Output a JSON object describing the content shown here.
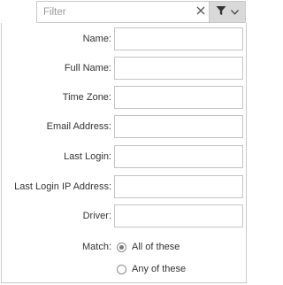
{
  "filter": {
    "placeholder": "Filter",
    "value": "",
    "clear_icon": "close-icon",
    "toggle_icons": [
      "funnel-icon",
      "chevron-down-icon"
    ]
  },
  "fields": [
    {
      "label": "Name:",
      "value": ""
    },
    {
      "label": "Full Name:",
      "value": ""
    },
    {
      "label": "Time Zone:",
      "value": ""
    },
    {
      "label": "Email Address:",
      "value": ""
    },
    {
      "label": "Last Login:",
      "value": ""
    },
    {
      "label": "Last Login IP Address:",
      "value": ""
    },
    {
      "label": "Driver:",
      "value": ""
    }
  ],
  "match": {
    "label": "Match:",
    "options": [
      "All of these",
      "Any of these"
    ],
    "selected": "All of these"
  }
}
